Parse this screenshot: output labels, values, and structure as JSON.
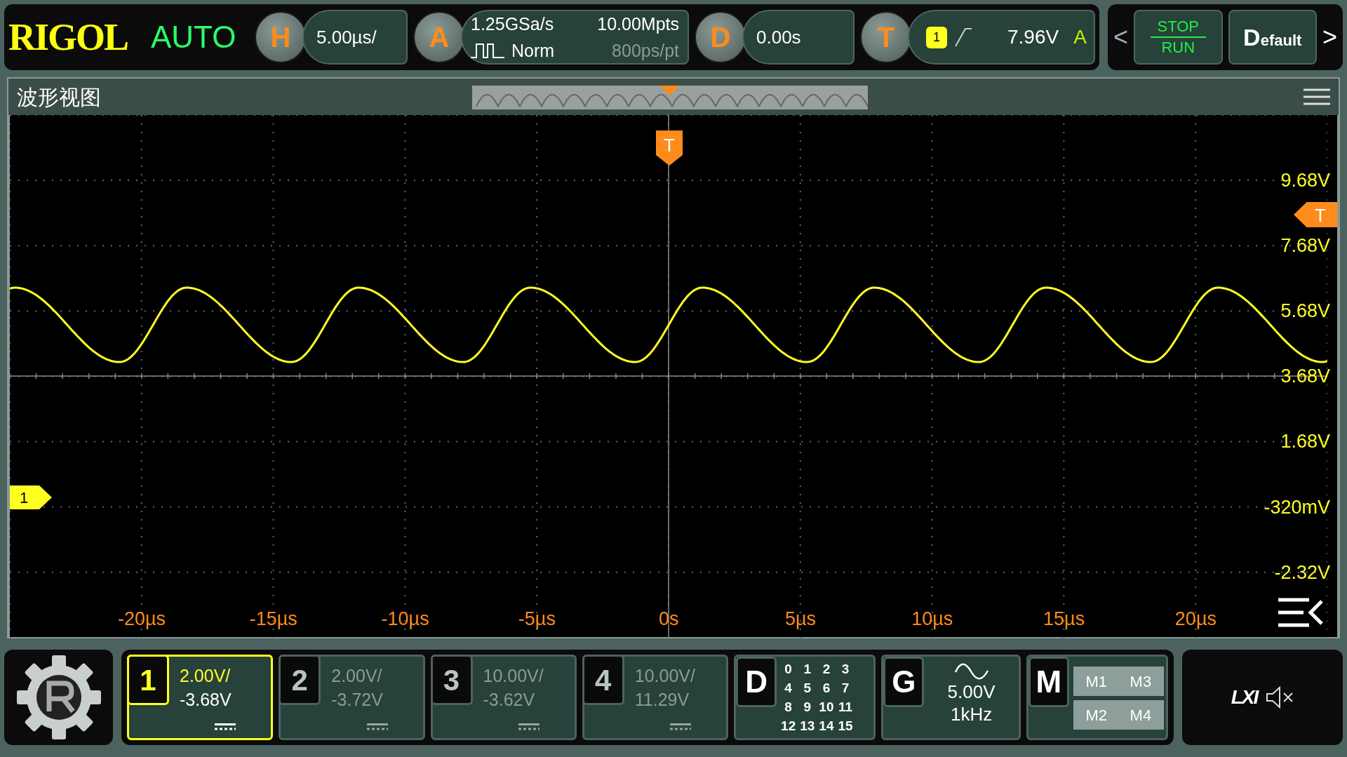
{
  "header": {
    "brand": "RIGOL",
    "mode": "AUTO"
  },
  "horizontal": {
    "key": "H",
    "scale": "5.00µs/"
  },
  "acquire": {
    "key": "A",
    "sample_rate": "1.25GSa/s",
    "mode": "Norm",
    "memory_depth": "10.00Mpts",
    "resolution": "800ps/pt"
  },
  "delay": {
    "key": "D",
    "value": "0.00s"
  },
  "trigger": {
    "key": "T",
    "source": "1",
    "level": "7.96V",
    "sweep": "A"
  },
  "controls": {
    "prev": "<",
    "stop": "STOP",
    "run": "RUN",
    "default": "Default",
    "next": ">"
  },
  "waveform_view": {
    "title": "波形视图",
    "trigger_marker": "T",
    "level_marker": "T",
    "channel_marker": "1",
    "time_labels": [
      "-20µs",
      "-15µs",
      "-10µs",
      "-5µs",
      "0s",
      "5µs",
      "10µs",
      "15µs",
      "20µs"
    ],
    "volt_labels": [
      "9.68V",
      "7.68V",
      "5.68V",
      "3.68V",
      "1.68V",
      "-320mV",
      "-2.32V"
    ]
  },
  "channels": [
    {
      "number": "1",
      "scale": "2.00V/",
      "offset": "-3.68V",
      "selected": true
    },
    {
      "number": "2",
      "scale": "2.00V/",
      "offset": "-3.72V",
      "selected": false
    },
    {
      "number": "3",
      "scale": "10.00V/",
      "offset": "-3.62V",
      "selected": false
    },
    {
      "number": "4",
      "scale": "10.00V/",
      "offset": "11.29V",
      "selected": false
    }
  ],
  "digital": {
    "key": "D",
    "bits": [
      "0",
      "1",
      "2",
      "3",
      "4",
      "5",
      "6",
      "7",
      "8",
      "9",
      "10",
      "11",
      "12",
      "13",
      "14",
      "15"
    ]
  },
  "generator": {
    "key": "G",
    "amplitude": "5.00V",
    "frequency": "1kHz"
  },
  "math": {
    "key": "M",
    "items": [
      "M1",
      "M3",
      "M2",
      "M4"
    ]
  },
  "status": {
    "lxi": "LXI"
  }
}
